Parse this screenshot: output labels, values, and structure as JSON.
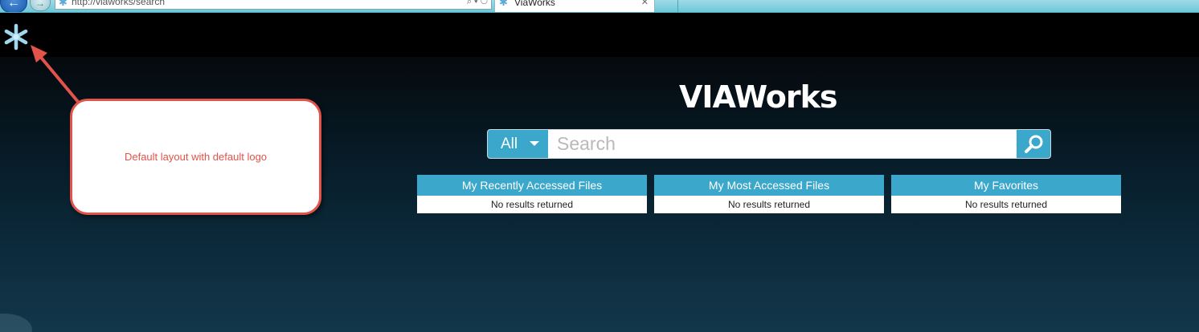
{
  "browser": {
    "address": "http://viaworks/search",
    "tab_title": "ViaWorks",
    "address_tools": "⌕ ▾ ↻",
    "tab_close": "✕"
  },
  "brand": {
    "name": "VIAWorks"
  },
  "search": {
    "scope": "All",
    "placeholder": "Search"
  },
  "panels": [
    {
      "title": "My Recently Accessed Files",
      "message": "No results returned"
    },
    {
      "title": "My Most Accessed Files",
      "message": "No results returned"
    },
    {
      "title": "My Favorites",
      "message": "No results returned"
    }
  ],
  "annotation": {
    "text": "Default layout with default logo"
  },
  "colors": {
    "accent": "#3ba7cb",
    "annotation": "#e2534a",
    "logo": "#9fd8ee"
  },
  "icons": {
    "logo": "asterisk-logo-icon",
    "search": "magnifier-icon",
    "dropdown": "caret-down-icon"
  }
}
